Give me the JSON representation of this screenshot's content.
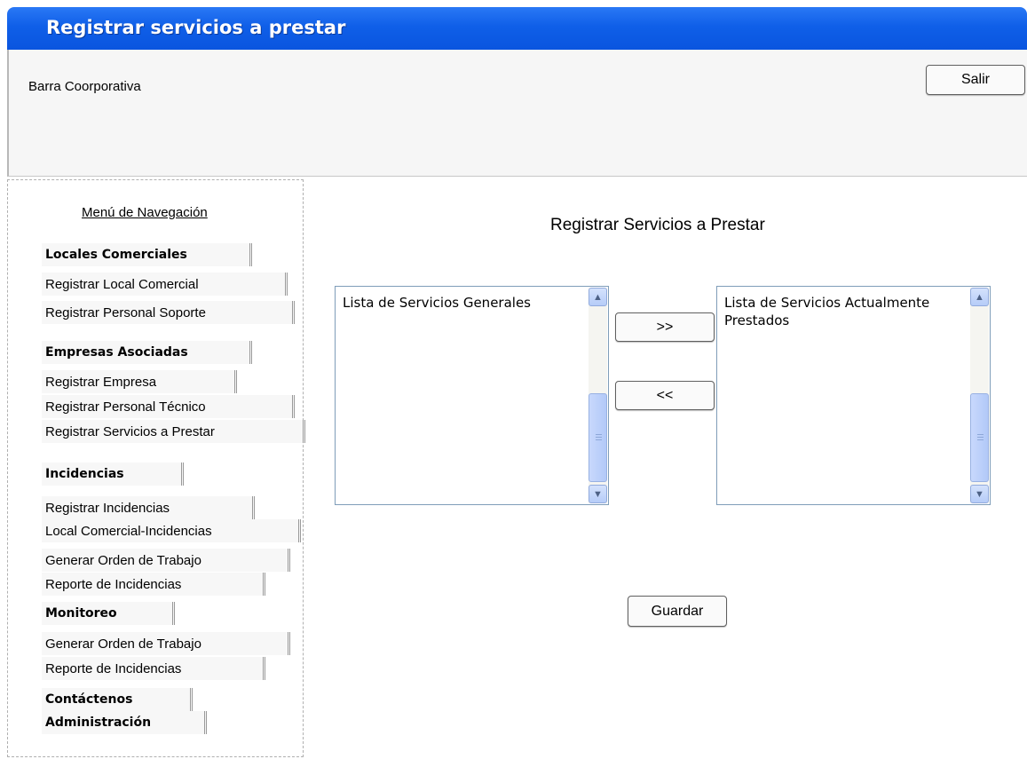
{
  "window": {
    "title": "Registrar servicios a prestar"
  },
  "corporate_bar": {
    "label": "Barra Coorporativa",
    "exit_button": "Salir"
  },
  "sidebar": {
    "heading": "Menú de Navegación",
    "items": [
      {
        "label": "Locales Comerciales",
        "group": true
      },
      {
        "label": "Registrar Local Comercial",
        "group": false
      },
      {
        "label": "Registrar Personal Soporte",
        "group": false
      },
      {
        "label": "Empresas Asociadas",
        "group": true
      },
      {
        "label": "Registrar Empresa",
        "group": false
      },
      {
        "label": "Registrar Personal Técnico",
        "group": false
      },
      {
        "label": "Registrar Servicios a Prestar",
        "group": false
      },
      {
        "label": "Incidencias",
        "group": true
      },
      {
        "label": "Registrar Incidencias",
        "group": false
      },
      {
        "label": "Local Comercial-Incidencias",
        "group": false
      },
      {
        "label": "Generar Orden de Trabajo",
        "group": false
      },
      {
        "label": "Reporte de Incidencias",
        "group": false
      },
      {
        "label": "Monitoreo",
        "group": true
      },
      {
        "label": "Generar Orden de Trabajo",
        "group": false
      },
      {
        "label": "Reporte de Incidencias",
        "group": false
      },
      {
        "label": "Contáctenos",
        "group": true
      },
      {
        "label": "Administración",
        "group": true
      }
    ]
  },
  "main": {
    "title": "Registrar Servicios a Prestar",
    "general_list": {
      "label": "Lista de Servicios Generales"
    },
    "current_list": {
      "label": "Lista de Servicios Actualmente Prestados"
    },
    "add_button": ">>",
    "remove_button": "<<",
    "save_button": "Guardar"
  },
  "icons": {
    "scroll_up": "chevron-up-icon",
    "scroll_down": "chevron-down-icon"
  }
}
